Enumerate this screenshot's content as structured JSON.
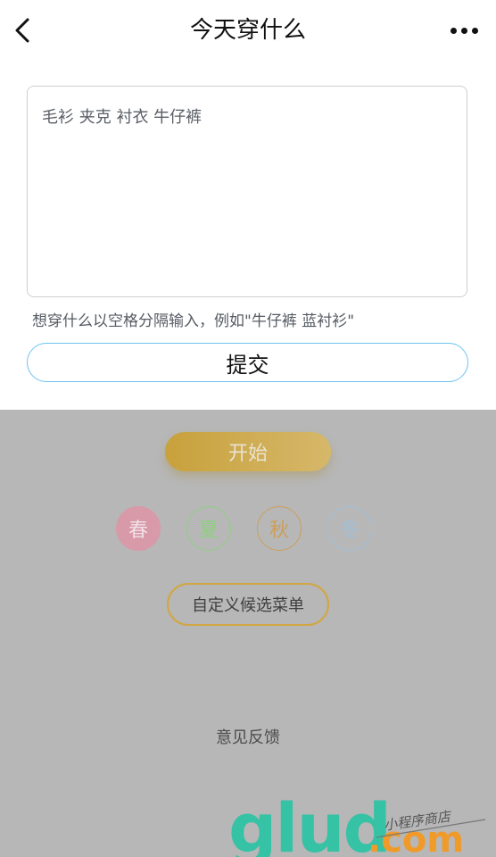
{
  "header": {
    "title": "今天穿什么",
    "back_icon": "chevron-left-icon",
    "more_icon": "more-dots-icon"
  },
  "input": {
    "value": "毛衫 夹克 衬衣 牛仔裤",
    "hint": "想穿什么以空格分隔输入，例如\"牛仔裤 蓝衬衫\""
  },
  "submit_label": "提交",
  "start_label": "开始",
  "seasons": [
    {
      "label": "春",
      "color": "#d899a8"
    },
    {
      "label": "夏",
      "color": "#8fcf82"
    },
    {
      "label": "秋",
      "color": "#cc9f5a"
    },
    {
      "label": "冬",
      "color": "#9fbfd9"
    }
  ],
  "custom_menu_label": "自定义候选菜单",
  "feedback_label": "意见反馈",
  "watermark": {
    "logo_text": "glud",
    "suffix": ".com",
    "slogan": "小程序商店"
  },
  "colors": {
    "overlay": "#b7b7b7",
    "submit_border": "#6cc4f0",
    "start_gold": "#c8a13c"
  }
}
